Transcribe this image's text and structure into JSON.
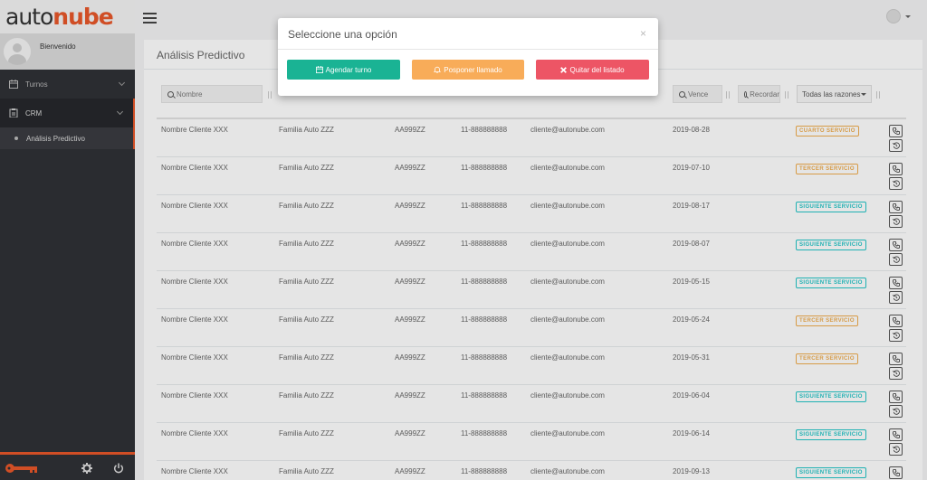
{
  "app": {
    "logo_part1": "auto",
    "logo_part2": "nube",
    "welcome": "Bienvenido"
  },
  "sidebar": {
    "items": [
      {
        "label": "Turnos",
        "icon": "calendar-icon"
      },
      {
        "label": "CRM",
        "icon": "clipboard-icon"
      }
    ],
    "sub_items": [
      {
        "label": "Análisis Predictivo"
      }
    ]
  },
  "page": {
    "title": "Análisis Predictivo"
  },
  "filters": {
    "nombre": "Nombre",
    "vence": "Vence",
    "recordar": "Recordar",
    "razones": "Todas las razones"
  },
  "table": {
    "rows": [
      {
        "nombre": "Nombre Cliente XXX",
        "familia": "Familia Auto ZZZ",
        "patente": "AA999ZZ",
        "telefono": "11-888888888",
        "email": "cliente@autonube.com",
        "fecha": "2019-08-28",
        "razon": "CUARTO SERVICIO",
        "tipo": "orange"
      },
      {
        "nombre": "Nombre Cliente XXX",
        "familia": "Familia Auto ZZZ",
        "patente": "AA999ZZ",
        "telefono": "11-888888888",
        "email": "cliente@autonube.com",
        "fecha": "2019-07-10",
        "razon": "TERCER SERVICIO",
        "tipo": "orange"
      },
      {
        "nombre": "Nombre Cliente XXX",
        "familia": "Familia Auto ZZZ",
        "patente": "AA999ZZ",
        "telefono": "11-888888888",
        "email": "cliente@autonube.com",
        "fecha": "2019-08-17",
        "razon": "SIGUIENTE SERVICIO",
        "tipo": "teal"
      },
      {
        "nombre": "Nombre Cliente XXX",
        "familia": "Familia Auto ZZZ",
        "patente": "AA999ZZ",
        "telefono": "11-888888888",
        "email": "cliente@autonube.com",
        "fecha": "2019-08-07",
        "razon": "SIGUIENTE SERVICIO",
        "tipo": "teal"
      },
      {
        "nombre": "Nombre Cliente XXX",
        "familia": "Familia Auto ZZZ",
        "patente": "AA999ZZ",
        "telefono": "11-888888888",
        "email": "cliente@autonube.com",
        "fecha": "2019-05-15",
        "razon": "SIGUIENTE SERVICIO",
        "tipo": "teal"
      },
      {
        "nombre": "Nombre Cliente XXX",
        "familia": "Familia Auto ZZZ",
        "patente": "AA999ZZ",
        "telefono": "11-888888888",
        "email": "cliente@autonube.com",
        "fecha": "2019-05-24",
        "razon": "TERCER SERVICIO",
        "tipo": "orange"
      },
      {
        "nombre": "Nombre Cliente XXX",
        "familia": "Familia Auto ZZZ",
        "patente": "AA999ZZ",
        "telefono": "11-888888888",
        "email": "cliente@autonube.com",
        "fecha": "2019-05-31",
        "razon": "TERCER SERVICIO",
        "tipo": "orange"
      },
      {
        "nombre": "Nombre Cliente XXX",
        "familia": "Familia Auto ZZZ",
        "patente": "AA999ZZ",
        "telefono": "11-888888888",
        "email": "cliente@autonube.com",
        "fecha": "2019-06-04",
        "razon": "SIGUIENTE SERVICIO",
        "tipo": "teal"
      },
      {
        "nombre": "Nombre Cliente XXX",
        "familia": "Familia Auto ZZZ",
        "patente": "AA999ZZ",
        "telefono": "11-888888888",
        "email": "cliente@autonube.com",
        "fecha": "2019-06-14",
        "razon": "SIGUIENTE SERVICIO",
        "tipo": "teal"
      },
      {
        "nombre": "Nombre Cliente XXX",
        "familia": "Familia Auto ZZZ",
        "patente": "AA999ZZ",
        "telefono": "11-888888888",
        "email": "cliente@autonube.com",
        "fecha": "2019-09-13",
        "razon": "SIGUIENTE SERVICIO",
        "tipo": "teal"
      }
    ]
  },
  "modal": {
    "title": "Seleccione una opción",
    "close": "×",
    "buttons": {
      "agendar": "Agendar turno",
      "posponer": "Posponer llamado",
      "quitar": "Quitar del listado"
    }
  },
  "colors": {
    "accent": "#e8572a",
    "green": "#1ab394",
    "yellow": "#f8ac59",
    "red": "#ed5565",
    "teal": "#23c6c8",
    "orange": "#f0ad4e"
  }
}
